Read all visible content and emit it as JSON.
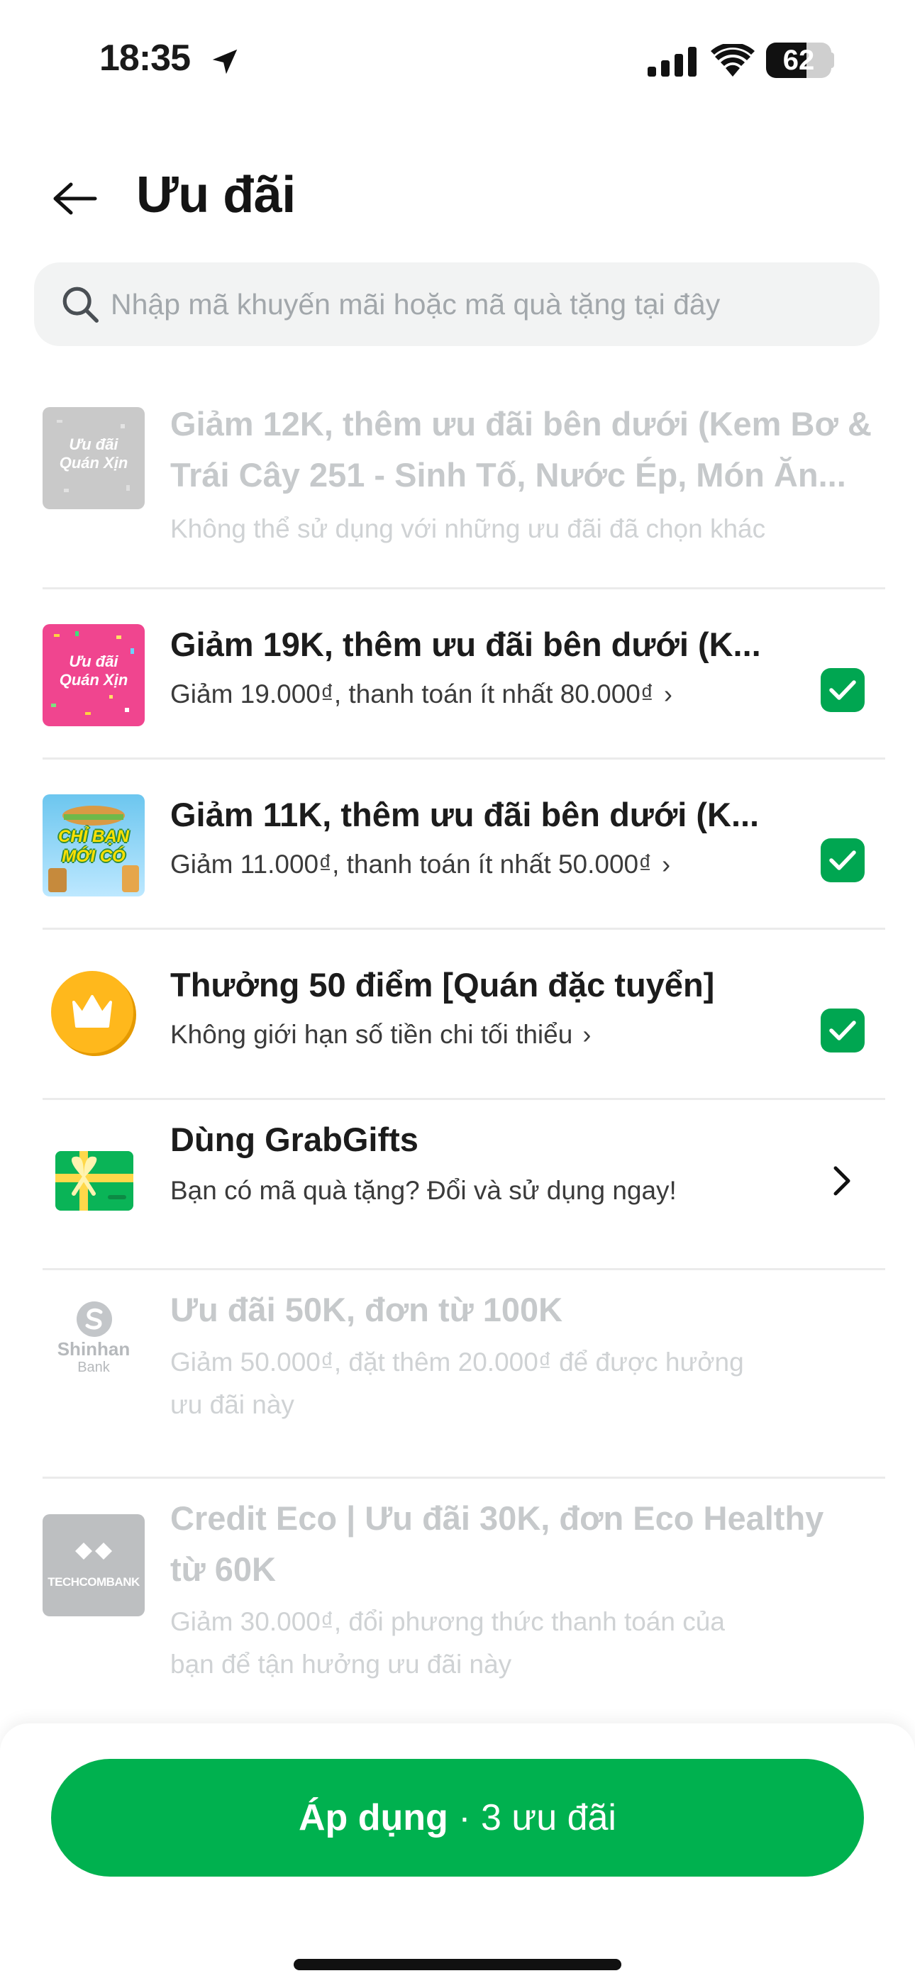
{
  "status_bar": {
    "time": "18:35",
    "battery": "62",
    "battery_level": 0.62
  },
  "header": {
    "title": "Ưu đãi"
  },
  "search": {
    "placeholder": "Nhập mã khuyến mãi hoặc mã quà tặng tại đây"
  },
  "offers": [
    {
      "thumb_text_1": "Ưu đãi",
      "thumb_text_2": "Quán Xịn",
      "title_line1": "Giảm 12K, thêm ưu đãi bên dưới (Kem Bơ &",
      "title_line2": "Trái Cây 251 - Sinh Tố, Nước Ép, Món Ăn...",
      "subtitle": "Không thể sử dụng với những ưu đãi đã chọn khác",
      "disabled": true
    },
    {
      "thumb_text_1": "Ưu đãi",
      "thumb_text_2": "Quán Xịn",
      "title": "Giảm 19K, thêm ưu đãi bên dưới (K...",
      "subtitle": "Giảm 19.000₫, thanh toán ít nhất 80.000₫",
      "checked": true
    },
    {
      "thumb_text_1": "CHỈ BẠN",
      "thumb_text_2": "MỚI CÓ",
      "title": "Giảm 11K, thêm ưu đãi bên dưới (K...",
      "subtitle": "Giảm 11.000₫, thanh toán ít nhất 50.000₫",
      "checked": true
    },
    {
      "icon": "crown-icon",
      "title": "Thưởng 50 điểm [Quán đặc tuyển]",
      "subtitle": "Không giới hạn số tiền chi tối thiểu",
      "checked": true
    },
    {
      "icon": "gift-card-icon",
      "title": "Dùng GrabGifts",
      "subtitle": "Bạn có mã quà tặng? Đổi và sử dụng ngay!"
    },
    {
      "bank_name": "Shinhan",
      "bank_sub": "Bank",
      "title": "Ưu đãi 50K, đơn từ 100K",
      "subtitle_line1": "Giảm 50.000₫, đặt thêm 20.000₫ để được hưởng",
      "subtitle_line2": "ưu đãi này",
      "disabled": true
    },
    {
      "bank_name": "TECHCOMBANK",
      "title_line1": "Credit Eco | Ưu đãi 30K, đơn Eco Healthy",
      "title_line2": "từ 60K",
      "subtitle_line1": "Giảm 30.000₫, đổi phương thức thanh toán của",
      "subtitle_line2": "bạn để tận hưởng ưu đãi này",
      "disabled": true
    }
  ],
  "footer": {
    "apply_label": "Áp dụng",
    "apply_separator": " · ",
    "apply_count": "3 ưu đãi"
  },
  "colors": {
    "brand_green": "#00b14f",
    "check_green": "#00a651",
    "pink_thumb": "#f0458f",
    "disabled_text": "#c6c9cb"
  }
}
